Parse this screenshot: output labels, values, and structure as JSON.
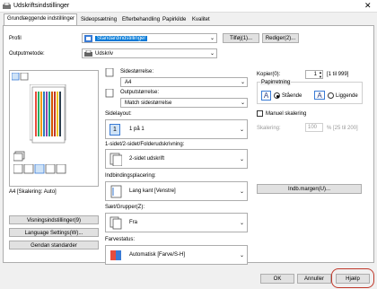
{
  "window": {
    "title": "Udskriftsindstillinger"
  },
  "tabs": [
    {
      "label": "Grundlæggende indstillinger"
    },
    {
      "label": "Sideopsætning"
    },
    {
      "label": "Efterbehandling"
    },
    {
      "label": "Papirkilde"
    },
    {
      "label": "Kvalitet"
    }
  ],
  "profile": {
    "label": "Profil",
    "value": "Standardindstillinger",
    "add_label": "Tilføj(1)...",
    "edit_label": "Rediger(2)..."
  },
  "output": {
    "label": "Outputmetode:",
    "value": "Udskriv"
  },
  "preview": {
    "caption": "A4 [Skalering: Auto]"
  },
  "left_buttons": {
    "view": "Visningsindstillinger(9)",
    "language": "Language Settings(W)...",
    "restore": "Gendan standarder"
  },
  "page_size": {
    "label": "Sidestørrelse:",
    "value": "A4"
  },
  "output_size": {
    "label": "Outputstørrelse:",
    "value": "Match sidestørrelse"
  },
  "page_layout": {
    "label": "Sidelayout:",
    "value": "1 på 1",
    "icon_num": "1"
  },
  "duplex": {
    "label": "1-sidet/2-sidet/Folderudskrivning:",
    "value": "2-sidet udskrift"
  },
  "binding": {
    "label": "Indbindingsplacering:",
    "value": "Lang kant [Venstre]",
    "margin_btn": "Indb.margen(U)..."
  },
  "collate": {
    "label": "Sæt/Grupper(Z):",
    "value": "Fra"
  },
  "color": {
    "label": "Farvestatus:",
    "value": "Automatisk [Farve/S-H]"
  },
  "copies": {
    "label": "Kopier(0):",
    "value": "1",
    "range": "[1 til 999]"
  },
  "orientation": {
    "label": "Papirretning",
    "portrait": "Stående",
    "landscape": "Liggende",
    "portrait_letter": "A",
    "landscape_letter": "A"
  },
  "manual_scaling": {
    "label": "Manuel skalering",
    "scaling_label": "Skalering:",
    "scaling_value": "100",
    "scaling_range": "% [25 til 200]"
  },
  "footer": {
    "ok": "OK",
    "cancel": "Annuller",
    "help": "Hjælp"
  },
  "colors": {
    "accent": "#0078d7",
    "highlight_ring": "#c0392b"
  }
}
